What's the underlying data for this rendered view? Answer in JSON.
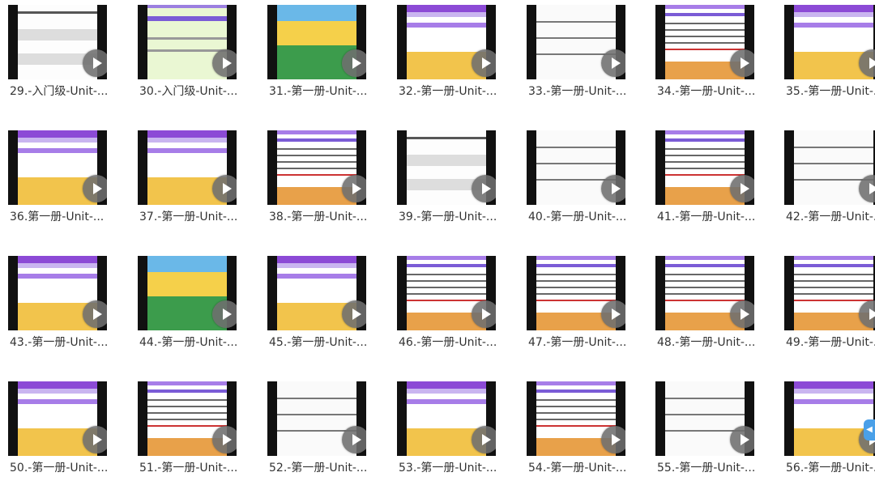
{
  "videos": [
    {
      "caption": "29.-入门级-Unit-...",
      "style": "worksheet"
    },
    {
      "caption": "30.-入门级-Unit-...",
      "style": "green"
    },
    {
      "caption": "31.-第一册-Unit-...",
      "style": "cartoon"
    },
    {
      "caption": "32.-第一册-Unit-...",
      "style": "app"
    },
    {
      "caption": "33.-第一册-Unit-...",
      "style": "sketch"
    },
    {
      "caption": "34.-第一册-Unit-...",
      "style": "text"
    },
    {
      "caption": "35.-第一册-Unit-...",
      "style": "app"
    },
    {
      "caption": "36.第一册-Unit-...",
      "style": "app"
    },
    {
      "caption": "37.-第一册-Unit-...",
      "style": "app"
    },
    {
      "caption": "38.-第一册-Unit-...",
      "style": "text"
    },
    {
      "caption": "39.-第一册-Unit-...",
      "style": "worksheet"
    },
    {
      "caption": "40.-第一册-Unit-...",
      "style": "sketch"
    },
    {
      "caption": "41.-第一册-Unit-...",
      "style": "text"
    },
    {
      "caption": "42.-第一册-Unit-...",
      "style": "sketch"
    },
    {
      "caption": "43.-第一册-Unit-...",
      "style": "app"
    },
    {
      "caption": "44.-第一册-Unit-...",
      "style": "cartoon"
    },
    {
      "caption": "45.-第一册-Unit-...",
      "style": "app"
    },
    {
      "caption": "46.-第一册-Unit-...",
      "style": "text"
    },
    {
      "caption": "47.-第一册-Unit-...",
      "style": "text"
    },
    {
      "caption": "48.-第一册-Unit-...",
      "style": "text"
    },
    {
      "caption": "49.-第一册-Unit-...",
      "style": "text"
    },
    {
      "caption": "50.-第一册-Unit-...",
      "style": "app"
    },
    {
      "caption": "51.-第一册-Unit-...",
      "style": "text"
    },
    {
      "caption": "52.-第一册-Unit-...",
      "style": "sketch"
    },
    {
      "caption": "53.-第一册-Unit-...",
      "style": "app"
    },
    {
      "caption": "54.-第一册-Unit-...",
      "style": "text"
    },
    {
      "caption": "55.-第一册-Unit-...",
      "style": "sketch"
    },
    {
      "caption": "56.-第一册-Unit-...",
      "style": "app"
    }
  ],
  "play_icon": "play-icon",
  "colors": {
    "thumb_bg": "#111111",
    "play_button": "#6e6e6e",
    "caption_text": "#333333",
    "app_bar": "#9b7fe0",
    "side_widget": "#4aa0e8"
  }
}
